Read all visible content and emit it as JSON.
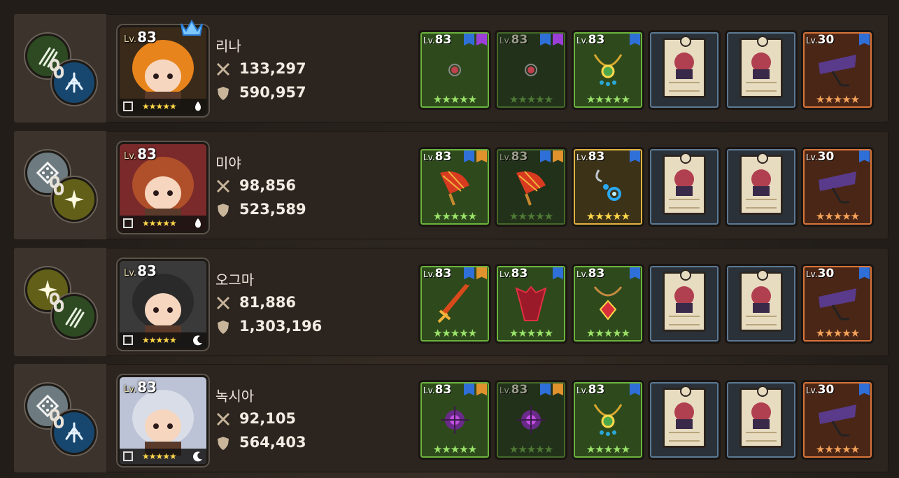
{
  "rows": [
    {
      "name": "리나",
      "level": "83",
      "lv_prefix": "Lv.",
      "attack": "133,297",
      "defense": "590,957",
      "has_crown": true,
      "chain_icons": [
        "claw-icon",
        "wing-icon"
      ],
      "portrait_icons": [
        "bow-class-icon",
        "fire-element-icon"
      ],
      "colors": {
        "hair": "#e8841c",
        "bg": "#3a2a1a"
      },
      "slots": [
        {
          "style": "green",
          "level": "83",
          "tags": [
            "blue",
            "purple"
          ],
          "item": "ring-icon",
          "stars": "★★★★★"
        },
        {
          "style": "dim",
          "level": "83",
          "tags": [
            "blue",
            "purple"
          ],
          "item": "ring-icon",
          "stars": "★★★★★"
        },
        {
          "style": "green",
          "level": "83",
          "tags": [
            "blue"
          ],
          "item": "necklace-icon",
          "stars": "★★★★★"
        },
        {
          "style": "blue",
          "level": "",
          "tags": [],
          "item": "card-icon",
          "stars": ""
        },
        {
          "style": "blue",
          "level": "",
          "tags": [],
          "item": "card-icon",
          "stars": ""
        },
        {
          "style": "orange",
          "level": "30",
          "tags": [
            "blue"
          ],
          "item": "costume-icon",
          "stars": "★★★★★"
        }
      ]
    },
    {
      "name": "미야",
      "level": "83",
      "lv_prefix": "Lv.",
      "attack": "98,856",
      "defense": "523,589",
      "has_crown": false,
      "chain_icons": [
        "dice-icon",
        "star-burst-icon"
      ],
      "portrait_icons": [
        "shield-class-icon",
        "fire-element-icon"
      ],
      "colors": {
        "hair": "#b0502a",
        "bg": "#7a2a2a"
      },
      "slots": [
        {
          "style": "green",
          "level": "83",
          "tags": [
            "blue",
            "orange"
          ],
          "item": "fan-icon",
          "stars": "★★★★★"
        },
        {
          "style": "dim",
          "level": "83",
          "tags": [
            "blue",
            "orange"
          ],
          "item": "fan-icon",
          "stars": "★★★★★"
        },
        {
          "style": "gold",
          "level": "83",
          "tags": [
            "blue"
          ],
          "item": "earring-icon",
          "stars": "★★★★★"
        },
        {
          "style": "blue",
          "level": "",
          "tags": [],
          "item": "card-icon",
          "stars": ""
        },
        {
          "style": "blue",
          "level": "",
          "tags": [],
          "item": "card-icon",
          "stars": ""
        },
        {
          "style": "orange",
          "level": "30",
          "tags": [
            "blue"
          ],
          "item": "costume-icon",
          "stars": "★★★★★"
        }
      ]
    },
    {
      "name": "오그마",
      "level": "83",
      "lv_prefix": "Lv.",
      "attack": "81,886",
      "defense": "1,303,196",
      "has_crown": false,
      "chain_icons": [
        "star-burst-icon",
        "claw-icon"
      ],
      "portrait_icons": [
        "guard-class-icon",
        "moon-element-icon"
      ],
      "colors": {
        "hair": "#2a2a2a",
        "bg": "#3a3a3a"
      },
      "slots": [
        {
          "style": "green",
          "level": "83",
          "tags": [
            "blue",
            "orange"
          ],
          "item": "sword-icon",
          "stars": "★★★★★"
        },
        {
          "style": "green",
          "level": "83",
          "tags": [
            "blue"
          ],
          "item": "armor-icon",
          "stars": "★★★★★"
        },
        {
          "style": "green",
          "level": "83",
          "tags": [
            "blue"
          ],
          "item": "pendant-icon",
          "stars": "★★★★★"
        },
        {
          "style": "blue",
          "level": "",
          "tags": [],
          "item": "card-icon",
          "stars": ""
        },
        {
          "style": "blue",
          "level": "",
          "tags": [],
          "item": "card-icon",
          "stars": ""
        },
        {
          "style": "orange",
          "level": "30",
          "tags": [
            "blue"
          ],
          "item": "costume-icon",
          "stars": "★★★★★"
        }
      ]
    },
    {
      "name": "녹시아",
      "level": "83",
      "lv_prefix": "Lv.",
      "attack": "92,105",
      "defense": "564,403",
      "has_crown": false,
      "chain_icons": [
        "dice-icon",
        "wing-icon"
      ],
      "portrait_icons": [
        "shield-class-icon",
        "moon-element-icon"
      ],
      "colors": {
        "hair": "#d8dde8",
        "bg": "#bcc3d6"
      },
      "slots": [
        {
          "style": "green",
          "level": "83",
          "tags": [
            "blue",
            "orange"
          ],
          "item": "orb-icon",
          "stars": "★★★★★"
        },
        {
          "style": "dim",
          "level": "83",
          "tags": [
            "blue",
            "orange"
          ],
          "item": "orb-icon",
          "stars": "★★★★★"
        },
        {
          "style": "green",
          "level": "83",
          "tags": [
            "blue"
          ],
          "item": "necklace-icon",
          "stars": "★★★★★"
        },
        {
          "style": "blue",
          "level": "",
          "tags": [],
          "item": "card-icon",
          "stars": ""
        },
        {
          "style": "blue",
          "level": "",
          "tags": [],
          "item": "card-icon",
          "stars": ""
        },
        {
          "style": "orange",
          "level": "30",
          "tags": [
            "blue"
          ],
          "item": "costume-icon",
          "stars": "★★★★★"
        }
      ]
    }
  ],
  "portrait_stars": "★★★★★"
}
